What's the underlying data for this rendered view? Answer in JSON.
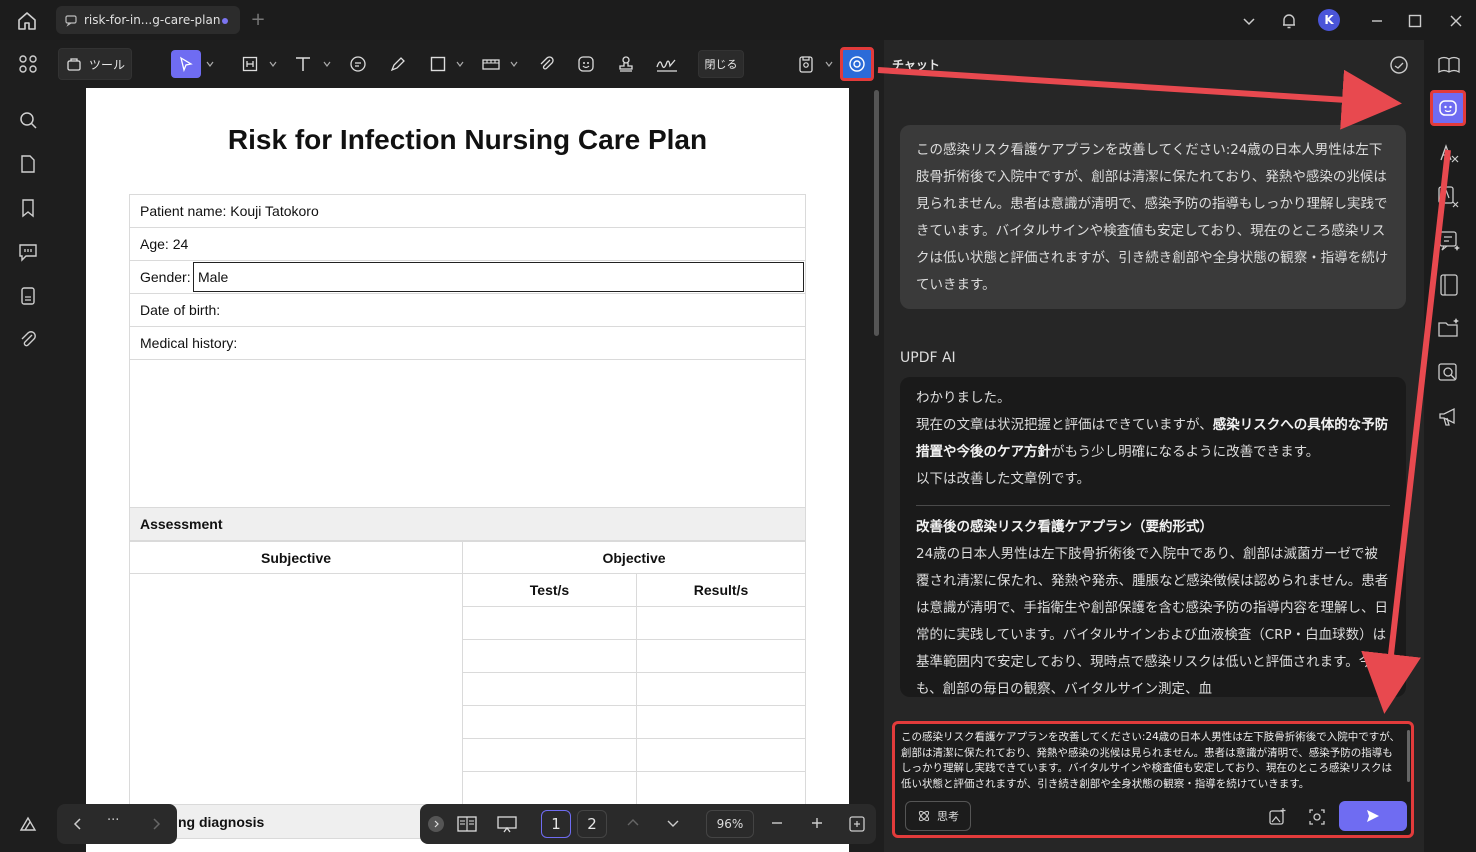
{
  "titlebar": {
    "tab_label": "risk-for-in...g-care-plan",
    "avatar_letter": "K"
  },
  "toolbar": {
    "tools_label": "ツール",
    "close_label": "閉じる"
  },
  "document": {
    "title": "Risk for Infection Nursing Care Plan",
    "patient_name": "Patient name: Kouji Tatokoro",
    "age": "Age: 24",
    "gender_label": "Gender:",
    "gender_value": "Male",
    "dob": "Date of birth:",
    "medical_history": "Medical history:",
    "assessment": "Assessment",
    "subjective": "Subjective",
    "objective": "Objective",
    "tests": "Test/s",
    "results": "Result/s",
    "diagnosis_partial": "ng diagnosis"
  },
  "bottombar": {
    "more": "···",
    "page1": "1",
    "page2": "2",
    "zoom": "96%"
  },
  "chat": {
    "title": "チャット",
    "user_message": "この感染リスク看護ケアプランを改善してください:24歳の日本人男性は左下肢骨折術後で入院中ですが、創部は清潔に保たれており、発熱や感染の兆候は見られません。患者は意識が清明で、感染予防の指導もしっかり理解し実践できています。バイタルサインや検査値も安定しており、現在のところ感染リスクは低い状態と評価されますが、引き続き創部や全身状態の観察・指導を続けていきます。",
    "ai_label": "UPDF AI",
    "ai_p1": "わかりました。",
    "ai_p2_a": "現在の文章は状況把握と評価はできていますが、",
    "ai_p2_b": "感染リスクへの具体的な予防措置や今後のケア方針",
    "ai_p2_c": "がもう少し明確になるように改善できます。",
    "ai_p3": "以下は改善した文章例です。",
    "ai_heading": "改善後の感染リスク看護ケアプラン（要約形式）",
    "ai_body": "24歳の日本人男性は左下肢骨折術後で入院中であり、創部は滅菌ガーゼで被覆され清潔に保たれ、発熱や発赤、腫脹など感染徴候は認められません。患者は意識が清明で、手指衛生や創部保護を含む感染予防の指導内容を理解し、日常的に実践しています。バイタルサインおよび血液検査（CRP・白血球数）は基準範囲内で安定しており、現時点で感染リスクは低いと評価されます。今後も、創部の毎日の観察、バイタルサイン測定、血",
    "input_text": "この感染リスク看護ケアプランを改善してください:24歳の日本人男性は左下肢骨折術後で入院中ですが、創部は清潔に保たれており、発熱や感染の兆候は見られません。患者は意識が清明で、感染予防の指導もしっかり理解し実践できています。バイタルサインや検査値も安定しており、現在のところ感染リスクは低い状態と評価されますが、引き続き創部や全身状態の観察・指導を続けていきます。",
    "think_label": "思考"
  },
  "colors": {
    "accent": "#6f6cf2",
    "highlight": "#e23b3b"
  }
}
